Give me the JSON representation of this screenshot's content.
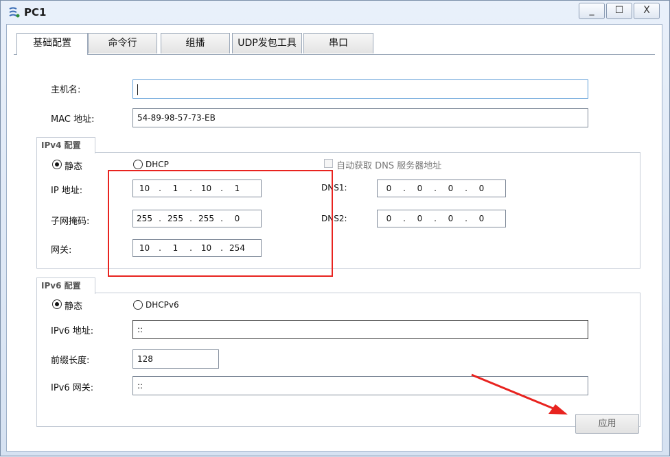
{
  "window": {
    "title": "PC1",
    "minimize": "_",
    "maximize": "☐",
    "close": "X"
  },
  "tabs": [
    "基础配置",
    "命令行",
    "组播",
    "UDP发包工具",
    "串口"
  ],
  "basic": {
    "hostname_label": "主机名:",
    "hostname_value": "",
    "mac_label": "MAC 地址:",
    "mac_value": "54-89-98-57-73-EB"
  },
  "ipv4": {
    "title": "IPv4 配置",
    "static_label": "静态",
    "dhcp_label": "DHCP",
    "auto_dns_label": "自动获取 DNS 服务器地址",
    "ip_label": "IP 地址:",
    "ip": [
      "10",
      "1",
      "10",
      "1"
    ],
    "mask_label": "子网掩码:",
    "mask": [
      "255",
      "255",
      "255",
      "0"
    ],
    "gateway_label": "网关:",
    "gateway": [
      "10",
      "1",
      "10",
      "254"
    ],
    "dns1_label": "DNS1:",
    "dns1": [
      "0",
      "0",
      "0",
      "0"
    ],
    "dns2_label": "DNS2:",
    "dns2": [
      "0",
      "0",
      "0",
      "0"
    ]
  },
  "ipv6": {
    "title": "IPv6 配置",
    "static_label": "静态",
    "dhcp_label": "DHCPv6",
    "addr_label": "IPv6 地址:",
    "addr_value": "::",
    "prefix_label": "前缀长度:",
    "prefix_value": "128",
    "gateway_label": "IPv6 网关:",
    "gateway_value": "::"
  },
  "apply_label": "应用",
  "colors": {
    "annotation": "#e8231f",
    "title_bar": "#dbe6f4"
  }
}
